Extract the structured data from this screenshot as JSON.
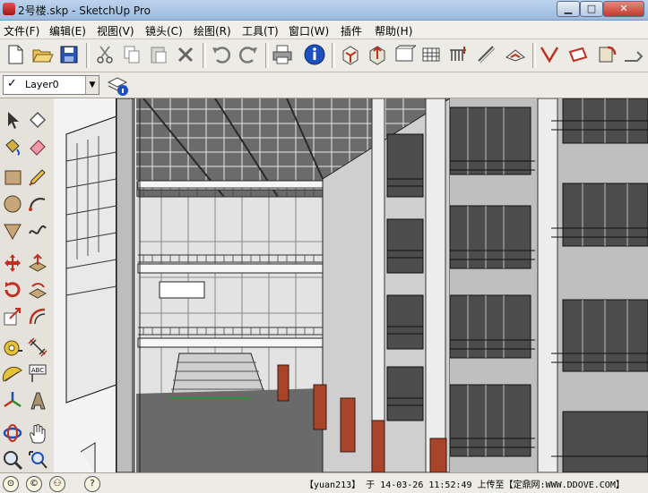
{
  "window": {
    "title": "2号楼.skp - SketchUp Pro",
    "minimize": "▁",
    "maximize": "□",
    "close": "✕"
  },
  "menu": [
    "文件(F)",
    "编辑(E)",
    "视图(V)",
    "镜头(C)",
    "绘图(R)",
    "工具(T)",
    "窗口(W)",
    "插件",
    "帮助(H)"
  ],
  "layer": {
    "name": "Layer0",
    "check": "✓",
    "arrow": "▼"
  },
  "status": {
    "text": "【yuan213】 于 14-03-26 11:52:49 上传至【定鼎网:WWW.DDOVE.COM】",
    "help_glyph": "?"
  },
  "colors": {
    "titlebar": "#9bb9dd",
    "toolbar": "#ecebe5",
    "accent": "#1e4fbf",
    "column": "#a8442a"
  }
}
